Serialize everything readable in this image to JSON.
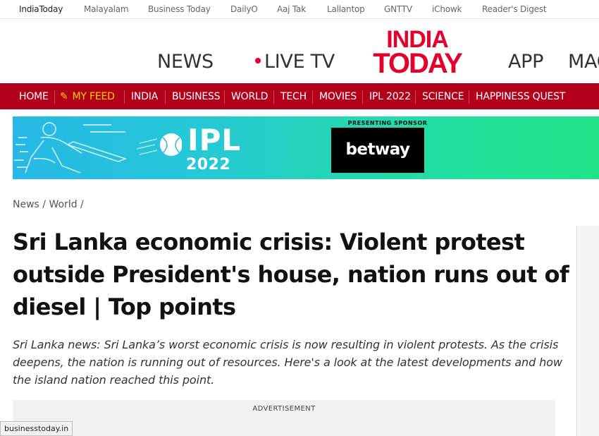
{
  "network_bar": {
    "items": [
      "IndiaToday",
      "Malayalam",
      "Business Today",
      "DailyO",
      "Aaj Tak",
      "Lallantop",
      "GNTTV",
      "iChowk",
      "Reader's Digest"
    ]
  },
  "header": {
    "nav": [
      "NEWS",
      "LIVE TV",
      "APP",
      "MAG"
    ],
    "logo_line1": "INDIA",
    "logo_line2": "TODAY"
  },
  "menu": {
    "items": [
      "HOME",
      "MY FEED",
      "INDIA",
      "BUSINESS",
      "WORLD",
      "TECH",
      "MOVIES",
      "IPL 2022",
      "SCIENCE",
      "HAPPINESS QUEST"
    ]
  },
  "banner": {
    "title": "IPL",
    "year": "2022",
    "sponsor_label": "PRESENTING SPONSOR",
    "sponsor_name": "betway"
  },
  "breadcrumb": {
    "items": [
      "News",
      "World"
    ],
    "separator": "/"
  },
  "article": {
    "headline": "Sri Lanka economic crisis: Violent protest outside President's house, nation runs out of diesel | Top points",
    "summary": "Sri Lanka news: Sri Lanka’s worst economic crisis is now resulting in violent protests. As the crisis deepens, the nation is running out of resources. Here's a look at the latest developments and how the island nation reached this point."
  },
  "advertisement": {
    "label": "ADVERTISEMENT"
  },
  "status_bar": {
    "url": "businesstoday.in"
  },
  "colors": {
    "brand_red": "#e4002b",
    "menu_red": "#b3001b",
    "feed_yellow": "#ffd400"
  },
  "icons": {
    "feed": "pencil-icon",
    "live": "live-dot-icon"
  }
}
